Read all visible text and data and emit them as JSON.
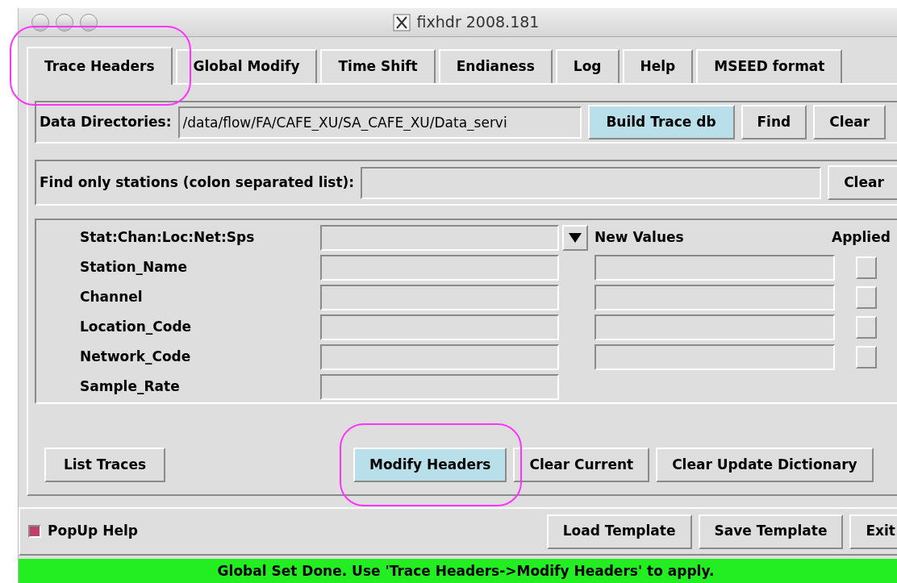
{
  "window": {
    "title": "fixhdr 2008.181"
  },
  "tabs": [
    {
      "label": "Trace Headers",
      "selected": true,
      "circled": true
    },
    {
      "label": "Global Modify",
      "selected": false,
      "circled": false
    },
    {
      "label": "Time Shift",
      "selected": false,
      "circled": false
    },
    {
      "label": "Endianess",
      "selected": false,
      "circled": false
    },
    {
      "label": "Log",
      "selected": false,
      "circled": false
    },
    {
      "label": "Help",
      "selected": false,
      "circled": false
    },
    {
      "label": "MSEED format",
      "selected": false,
      "circled": false
    }
  ],
  "data_directories": {
    "label": "Data Directories:",
    "value": "/data/flow/FA/CAFE_XU/SA_CAFE_XU/Data_servi",
    "buttons": [
      {
        "label": "Build Trace db",
        "highlighted": true
      },
      {
        "label": "Find",
        "highlighted": false
      },
      {
        "label": "Clear",
        "highlighted": false
      }
    ]
  },
  "station_filter": {
    "label": "Find only stations (colon separated list):",
    "button": "Clear"
  },
  "headers": {
    "selector_label": "Stat:Chan:Loc:Net:Sps",
    "new_values_label": "New Values",
    "applied_label": "Applied",
    "fields": [
      {
        "label": "Station_Name",
        "has_new_value": true,
        "applied": false
      },
      {
        "label": "Channel",
        "has_new_value": true,
        "applied": false
      },
      {
        "label": "Location_Code",
        "has_new_value": true,
        "applied": false
      },
      {
        "label": "Network_Code",
        "has_new_value": true,
        "applied": false
      },
      {
        "label": "Sample_Rate",
        "has_new_value": false
      }
    ]
  },
  "actions": [
    {
      "label": "List Traces",
      "highlighted": false,
      "circled": false
    },
    {
      "label": "Modify Headers",
      "highlighted": true,
      "circled": true
    },
    {
      "label": "Clear Current",
      "highlighted": false,
      "circled": false
    },
    {
      "label": "Clear Update Dictionary",
      "highlighted": false,
      "circled": false
    }
  ],
  "popup_help": {
    "label": "PopUp Help",
    "checked": true
  },
  "template_buttons": [
    "Load Template",
    "Save Template",
    "Exit"
  ],
  "status_bar": {
    "text": "Global Set Done. Use 'Trace Headers->Modify Headers' to apply."
  }
}
